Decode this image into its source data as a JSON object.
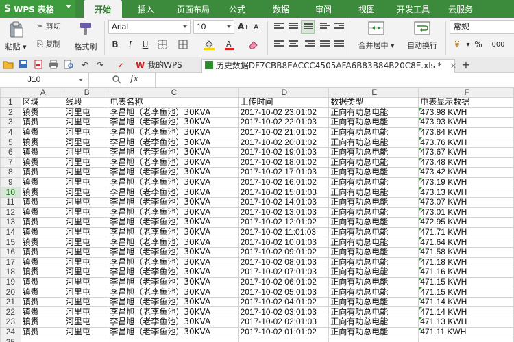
{
  "app": {
    "name": "WPS 表格",
    "logo": "S"
  },
  "menu": {
    "tabs": [
      "开始",
      "插入",
      "页面布局",
      "公式",
      "数据",
      "审阅",
      "视图",
      "开发工具",
      "云服务"
    ],
    "active": 0
  },
  "ribbon": {
    "paste": "粘贴",
    "cut": "剪切",
    "copy": "复制",
    "format_painter": "格式刷",
    "font_name": "Arial",
    "font_size": "10",
    "bold": "B",
    "italic": "I",
    "underline": "U",
    "merge_center": "合并居中",
    "wrap_text": "自动换行",
    "number_format": "常规",
    "percent": "%",
    "thousands": "000"
  },
  "tabbar": {
    "tabs": [
      {
        "label": "我的WPS",
        "icon": "wps-icon"
      },
      {
        "label": "历史数据DF7CBB8EACCC4505AFA6B83B84B20C8E.xls *",
        "icon": "spreadsheet-icon"
      }
    ],
    "add": "+"
  },
  "formula_bar": {
    "name_box": "J10",
    "fx": "fx",
    "content": ""
  },
  "sheet": {
    "columns": [
      "A",
      "B",
      "C",
      "D",
      "E",
      "F"
    ],
    "header_row": [
      "区域",
      "线段",
      "电表名称",
      "上传时间",
      "数据类型",
      "电表显示数据"
    ],
    "selected_row": 10,
    "rows": [
      [
        "镇赉",
        "河里屯",
        "李昌旭（老李鱼池）30KVA",
        "2017-10-02 23:01:02",
        "正向有功总电能",
        "473.98 KWH"
      ],
      [
        "镇赉",
        "河里屯",
        "李昌旭（老李鱼池）30KVA",
        "2017-10-02 22:01:03",
        "正向有功总电能",
        "473.93 KWH"
      ],
      [
        "镇赉",
        "河里屯",
        "李昌旭（老李鱼池）30KVA",
        "2017-10-02 21:01:02",
        "正向有功总电能",
        "473.84 KWH"
      ],
      [
        "镇赉",
        "河里屯",
        "李昌旭（老李鱼池）30KVA",
        "2017-10-02 20:01:02",
        "正向有功总电能",
        "473.76 KWH"
      ],
      [
        "镇赉",
        "河里屯",
        "李昌旭（老李鱼池）30KVA",
        "2017-10-02 19:01:03",
        "正向有功总电能",
        "473.67 KWH"
      ],
      [
        "镇赉",
        "河里屯",
        "李昌旭（老李鱼池）30KVA",
        "2017-10-02 18:01:02",
        "正向有功总电能",
        "473.48 KWH"
      ],
      [
        "镇赉",
        "河里屯",
        "李昌旭（老李鱼池）30KVA",
        "2017-10-02 17:01:03",
        "正向有功总电能",
        "473.42 KWH"
      ],
      [
        "镇赉",
        "河里屯",
        "李昌旭（老李鱼池）30KVA",
        "2017-10-02 16:01:02",
        "正向有功总电能",
        "473.19 KWH"
      ],
      [
        "镇赉",
        "河里屯",
        "李昌旭（老李鱼池）30KVA",
        "2017-10-02 15:01:03",
        "正向有功总电能",
        "473.13 KWH"
      ],
      [
        "镇赉",
        "河里屯",
        "李昌旭（老李鱼池）30KVA",
        "2017-10-02 14:01:03",
        "正向有功总电能",
        "473.07 KWH"
      ],
      [
        "镇赉",
        "河里屯",
        "李昌旭（老李鱼池）30KVA",
        "2017-10-02 13:01:03",
        "正向有功总电能",
        "473.01 KWH"
      ],
      [
        "镇赉",
        "河里屯",
        "李昌旭（老李鱼池）30KVA",
        "2017-10-02 12:01:02",
        "正向有功总电能",
        "472.95 KWH"
      ],
      [
        "镇赉",
        "河里屯",
        "李昌旭（老李鱼池）30KVA",
        "2017-10-02 11:01:03",
        "正向有功总电能",
        "471.71 KWH"
      ],
      [
        "镇赉",
        "河里屯",
        "李昌旭（老李鱼池）30KVA",
        "2017-10-02 10:01:03",
        "正向有功总电能",
        "471.64 KWH"
      ],
      [
        "镇赉",
        "河里屯",
        "李昌旭（老李鱼池）30KVA",
        "2017-10-02 09:01:02",
        "正向有功总电能",
        "471.58 KWH"
      ],
      [
        "镇赉",
        "河里屯",
        "李昌旭（老李鱼池）30KVA",
        "2017-10-02 08:01:03",
        "正向有功总电能",
        "471.18 KWH"
      ],
      [
        "镇赉",
        "河里屯",
        "李昌旭（老李鱼池）30KVA",
        "2017-10-02 07:01:03",
        "正向有功总电能",
        "471.16 KWH"
      ],
      [
        "镇赉",
        "河里屯",
        "李昌旭（老李鱼池）30KVA",
        "2017-10-02 06:01:02",
        "正向有功总电能",
        "471.15 KWH"
      ],
      [
        "镇赉",
        "河里屯",
        "李昌旭（老李鱼池）30KVA",
        "2017-10-02 05:01:03",
        "正向有功总电能",
        "471.15 KWH"
      ],
      [
        "镇赉",
        "河里屯",
        "李昌旭（老李鱼池）30KVA",
        "2017-10-02 04:01:02",
        "正向有功总电能",
        "471.14 KWH"
      ],
      [
        "镇赉",
        "河里屯",
        "李昌旭（老李鱼池）30KVA",
        "2017-10-02 03:01:03",
        "正向有功总电能",
        "471.14 KWH"
      ],
      [
        "镇赉",
        "河里屯",
        "李昌旭（老李鱼池）30KVA",
        "2017-10-02 02:01:03",
        "正向有功总电能",
        "471.13 KWH"
      ],
      [
        "镇赉",
        "河里屯",
        "李昌旭（老李鱼池）30KVA",
        "2017-10-02 01:01:02",
        "正向有功总电能",
        "471.11 KWH"
      ]
    ],
    "next_row_number": "25"
  },
  "colors": {
    "title_bar": "#3c8a3c",
    "accent": "#2e7d2e",
    "grid_line": "#d4d4d4"
  }
}
